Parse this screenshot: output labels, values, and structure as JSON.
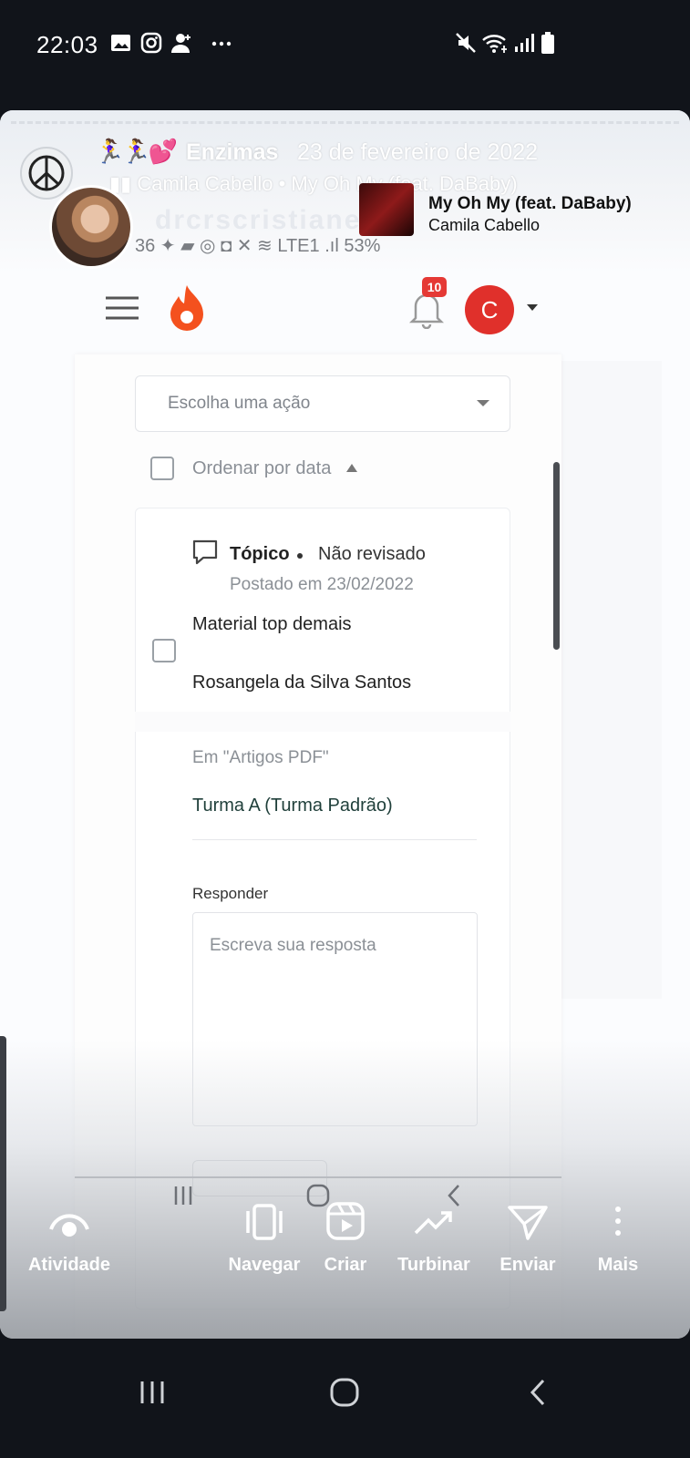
{
  "status_bar": {
    "time": "22:03",
    "icons": [
      "gallery-icon",
      "instagram-icon",
      "add-user-icon",
      "more-dots-icon",
      "mute-icon",
      "wifi-icon",
      "signal-icon",
      "battery-icon"
    ]
  },
  "story": {
    "emoji": "🏃‍♀️🏃‍♀️💕",
    "username": "Enzimas",
    "date": "23 de fevereiro de 2022",
    "music_line": "▮▮ Camila Cabello • My Oh My (feat. DaBaby)",
    "song_title": "My Oh My (feat. DaBaby)",
    "song_artist": "Camila Cabello",
    "ghost_text": "drcrscristiane",
    "inner_status": "36 ✦ ▰ ◎ ◘      ✕ ≋ LTE1 .ıl 53%"
  },
  "app": {
    "notification_count": "10",
    "user_initial": "C",
    "action_select": "Escolha uma ação",
    "order_label": "Ordenar por data",
    "post": {
      "type": "Tópico",
      "status": "Não revisado",
      "posted": "Postado em 23/02/2022",
      "title": "Material top demais",
      "author": "Rosangela da Silva Santos",
      "in_label": "Em \"Artigos PDF\"",
      "class": "Turma A (Turma Padrão)",
      "reply_label": "Responder",
      "reply_placeholder": "Escreva sua resposta"
    }
  },
  "actions": [
    {
      "label": "Atividade"
    },
    {
      "label": "Navegar"
    },
    {
      "label": "Criar"
    },
    {
      "label": "Turbinar"
    },
    {
      "label": "Enviar"
    },
    {
      "label": "Mais"
    }
  ],
  "colors": {
    "accent": "#e0302b",
    "flame": "#f4511e",
    "badge": "#e53935"
  }
}
